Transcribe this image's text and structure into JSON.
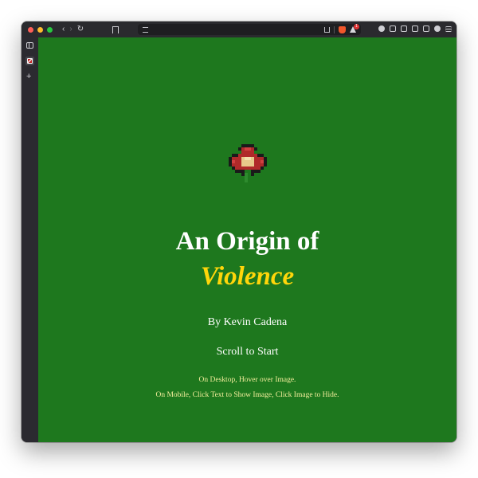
{
  "browser": {
    "shields_badge_count": "1",
    "colors": {
      "chrome": "#2a2a2e",
      "address_bar": "#1e1e21",
      "brave_accent": "#f1562b"
    }
  },
  "page": {
    "background_color": "#1e781e",
    "flower_icon": "pixel-flower-icon",
    "title_line1": "An Origin of",
    "title_line2": "Violence",
    "title_accent_color": "#ffd60a",
    "byline": "By Kevin Cadena",
    "scroll_prompt": "Scroll to Start",
    "hint_desktop": "On Desktop, Hover over Image.",
    "hint_mobile": "On Mobile, Click Text to Show Image, Click Image to Hide."
  }
}
